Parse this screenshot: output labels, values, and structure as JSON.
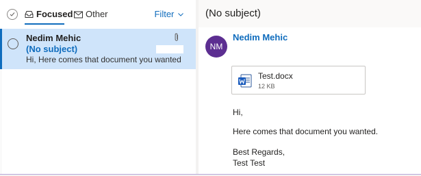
{
  "list": {
    "tabs": [
      {
        "label": "Focused",
        "icon": "inbox-icon"
      },
      {
        "label": "Other",
        "icon": "mail-icon"
      }
    ],
    "filter_label": "Filter",
    "message": {
      "from": "Nedim Mehic",
      "subject": "(No subject)",
      "preview": "Hi, Here comes that document you wanted. Be..."
    }
  },
  "reading": {
    "subject": "(No subject)",
    "avatar_initials": "NM",
    "sender": "Nedim Mehic",
    "attachment": {
      "name": "Test.docx",
      "size": "12 KB",
      "icon": "word-icon"
    },
    "body": {
      "greeting": "Hi,",
      "line1": "Here comes that document you wanted.",
      "closing": "Best Regards,",
      "signature": "Test Test"
    }
  },
  "colors": {
    "accent": "#0f6cbd",
    "selected_bg": "#cfe4fa",
    "avatar_bg": "#5c2e91"
  }
}
